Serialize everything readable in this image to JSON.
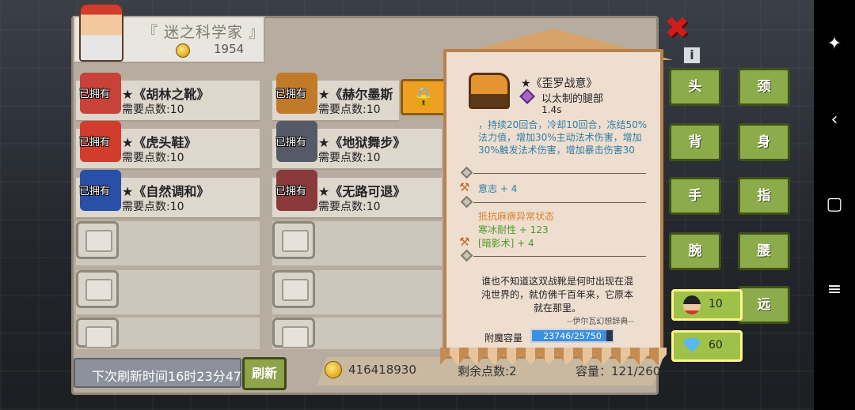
{
  "header": {
    "title": "『 迷之科学家 』",
    "gold": "1954"
  },
  "items": [
    {
      "name": "★《胡林之靴》",
      "need": "需要点数:10",
      "owned": "已拥有",
      "color": "#c8423a"
    },
    {
      "name": "★《赫尔墨斯",
      "need": "需要点数:10",
      "owned": "已拥有",
      "color": "#c07a2a"
    },
    {
      "name": "★《虎头鞋》",
      "need": "需要点数:10",
      "owned": "已拥有",
      "color": "#d23c2c"
    },
    {
      "name": "★《地狱舞步》",
      "need": "需要点数:10",
      "owned": "已拥有",
      "color": "#555a66"
    },
    {
      "name": "★《自然调和》",
      "need": "需要点数:10",
      "owned": "已拥有",
      "color": "#2a4fa8"
    },
    {
      "name": "★《无路可退》",
      "need": "需要点数:10",
      "owned": "已拥有",
      "color": "#8a3a3a"
    }
  ],
  "footer": {
    "refresh_time": "下次刷新时间16时23分47",
    "refresh_button": "刷新",
    "total_gold": "416418930",
    "remaining_points": "剩余点数:2",
    "capacity": "容量：121/260"
  },
  "tooltip": {
    "name": "★《歪罗战意》",
    "material": "以太制的腿部",
    "speed": "1.4s",
    "description": "，持续20回合，冷却10回合，冻结50%法力值，增加30%主动法术伤害，增加30%触发法术伤害，增加暴击伤害30",
    "stat_will": "意志 + 4",
    "stat_paralysis": "抵抗麻痹异常状态",
    "stat_cold": "寒冰耐性 + 123",
    "stat_shadow": "[暗影术] + 4",
    "lore": "谁也不知道这双战靴是何时出现在混沌世界的，就仿佛千百年来，它原本就在那里。",
    "quote": "--伊尔瓦幻想辞典--",
    "enchant_label": "附魔容量",
    "enchant_value": "23746/25750",
    "enchant_fraction": 0.922
  },
  "equip_slots": [
    "头",
    "颈",
    "背",
    "身",
    "手",
    "指",
    "腕",
    "腰",
    "远"
  ],
  "currency": {
    "heads": "10",
    "gems": "60"
  },
  "buttons": {
    "close": "✖",
    "info": "i",
    "lock": "🔒"
  },
  "system_nav": {
    "accessibility": "✦",
    "back": "‹",
    "home": "▢",
    "menu": "≡"
  }
}
